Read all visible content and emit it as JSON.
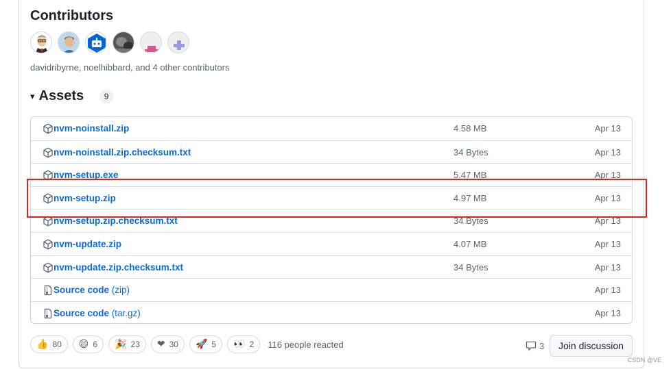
{
  "contributors": {
    "title": "Contributors",
    "avatars": [
      {
        "name": "avatar-cartoon-man"
      },
      {
        "name": "avatar-man-photo"
      },
      {
        "name": "avatar-bot"
      },
      {
        "name": "avatar-grayscale"
      },
      {
        "name": "avatar-pink-identicon"
      },
      {
        "name": "avatar-purple-identicon"
      }
    ],
    "summary": "davidribyrne, noelhibbard, and 4 other contributors"
  },
  "assets": {
    "caret": "▾",
    "title": "Assets",
    "count": "9",
    "items": [
      {
        "name": "nvm-noinstall.zip",
        "suffix": "",
        "size": "4.58 MB",
        "date": "Apr 13",
        "icon": "package-icon"
      },
      {
        "name": "nvm-noinstall.zip.checksum.txt",
        "suffix": "",
        "size": "34 Bytes",
        "date": "Apr 13",
        "icon": "package-icon"
      },
      {
        "name": "nvm-setup.exe",
        "suffix": "",
        "size": "5.47 MB",
        "date": "Apr 13",
        "icon": "package-icon"
      },
      {
        "name": "nvm-setup.zip",
        "suffix": "",
        "size": "4.97 MB",
        "date": "Apr 13",
        "icon": "package-icon"
      },
      {
        "name": "nvm-setup.zip.checksum.txt",
        "suffix": "",
        "size": "34 Bytes",
        "date": "Apr 13",
        "icon": "package-icon"
      },
      {
        "name": "nvm-update.zip",
        "suffix": "",
        "size": "4.07 MB",
        "date": "Apr 13",
        "icon": "package-icon"
      },
      {
        "name": "nvm-update.zip.checksum.txt",
        "suffix": "",
        "size": "34 Bytes",
        "date": "Apr 13",
        "icon": "package-icon"
      },
      {
        "name": "Source code",
        "suffix": " (zip)",
        "size": "",
        "date": "Apr 13",
        "icon": "file-zip-icon"
      },
      {
        "name": "Source code",
        "suffix": " (tar.gz)",
        "size": "",
        "date": "Apr 13",
        "icon": "file-zip-icon"
      }
    ]
  },
  "reactions": {
    "items": [
      {
        "emoji": "👍",
        "count": "80",
        "icon": "thumbs-up-icon"
      },
      {
        "emoji": "😄",
        "count": "6",
        "icon": "laugh-icon"
      },
      {
        "emoji": "🎉",
        "count": "23",
        "icon": "hooray-icon"
      },
      {
        "emoji": "❤",
        "count": "30",
        "icon": "heart-icon"
      },
      {
        "emoji": "🚀",
        "count": "5",
        "icon": "rocket-icon"
      },
      {
        "emoji": "👀",
        "count": "2",
        "icon": "eyes-icon"
      }
    ],
    "summary": "116 people reacted"
  },
  "discussion": {
    "comment_count": "3",
    "join_label": "Join discussion"
  },
  "watermark": "CSDN @VE"
}
